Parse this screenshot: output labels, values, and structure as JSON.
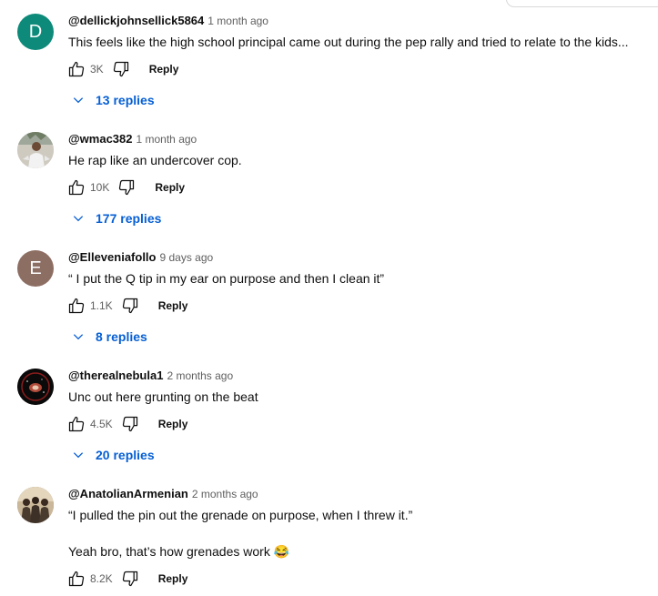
{
  "comments": [
    {
      "avatar_letter": "D",
      "avatar_color": "#0d8a79",
      "author": "@dellickjohnsellick5864",
      "time": "1 month ago",
      "text": "This feels like the high school principal came out during the pep rally and tried to relate to the kids...",
      "likes": "3K",
      "reply_label": "Reply",
      "replies_label": "13 replies"
    },
    {
      "avatar_kind": "photo-person",
      "author": "@wmac382",
      "time": "1 month ago",
      "text": "He rap like an undercover cop.",
      "likes": "10K",
      "reply_label": "Reply",
      "replies_label": "177 replies"
    },
    {
      "avatar_letter": "E",
      "avatar_color": "#8d6e63",
      "author": "@Elleveniafollo",
      "time": "9 days ago",
      "text": "“ I put the Q tip in my ear on purpose and then I clean it”",
      "likes": "1.1K",
      "reply_label": "Reply",
      "replies_label": "8 replies"
    },
    {
      "avatar_kind": "logo-the-real-nebula",
      "avatar_logo_text": "THE REAL NEBULA",
      "author": "@therealnebula1",
      "time": "2 months ago",
      "text": "Unc out here grunting on the beat",
      "likes": "4.5K",
      "reply_label": "Reply",
      "replies_label": "20 replies"
    },
    {
      "avatar_kind": "photo-group",
      "author": "@AnatolianArmenian",
      "time": "2 months ago",
      "text_line1": "“I pulled the pin out the grenade on purpose, when I threw it.”",
      "text_line2": "Yeah bro, that’s how grenades work 😂",
      "likes": "8.2K",
      "reply_label": "Reply"
    }
  ],
  "icons": {
    "like": "thumbs-up-icon",
    "dislike": "thumbs-down-icon",
    "expand": "chevron-down-icon"
  },
  "colors": {
    "link_blue": "#065fd4",
    "secondary_text": "#606060"
  }
}
